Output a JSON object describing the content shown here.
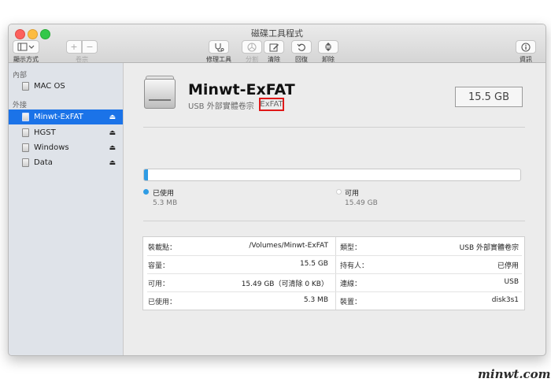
{
  "window": {
    "title": "磁碟工具程式"
  },
  "toolbar": {
    "view_label": "顯示方式",
    "volume_label": "卷宗",
    "volume_add": "+",
    "volume_remove": "−",
    "first_aid": "修理工具",
    "partition": "分割",
    "erase": "清除",
    "restore": "回復",
    "unmount": "卸除",
    "info": "資訊"
  },
  "sidebar": {
    "internal_header": "內部",
    "external_header": "外接",
    "internal_items": [
      {
        "label": "MAC OS"
      }
    ],
    "external_items": [
      {
        "label": "Minwt-ExFAT",
        "selected": true
      },
      {
        "label": "HGST"
      },
      {
        "label": "Windows"
      },
      {
        "label": "Data"
      }
    ]
  },
  "volume": {
    "name": "Minwt-ExFAT",
    "subtitle": "USB 外部實體卷宗",
    "filesystem": "ExFAT",
    "capacity": "15.5 GB"
  },
  "usage": {
    "used_label": "已使用",
    "used_value": "5.3 MB",
    "free_label": "可用",
    "free_value": "15.49 GB",
    "used_color": "#2f9ce4",
    "used_fraction": 0.0003
  },
  "info": {
    "left": [
      {
        "key": "裝載點：",
        "value": "/Volumes/Minwt-ExFAT"
      },
      {
        "key": "容量：",
        "value": "15.5 GB"
      },
      {
        "key": "可用：",
        "value": "15.49 GB（可清除 0 KB）"
      },
      {
        "key": "已使用：",
        "value": "5.3 MB"
      }
    ],
    "right": [
      {
        "key": "類型：",
        "value": "USB 外部實體卷宗"
      },
      {
        "key": "持有人：",
        "value": "已停用"
      },
      {
        "key": "連線：",
        "value": "USB"
      },
      {
        "key": "裝置：",
        "value": "disk3s1"
      }
    ]
  },
  "watermark": "minwt.com"
}
